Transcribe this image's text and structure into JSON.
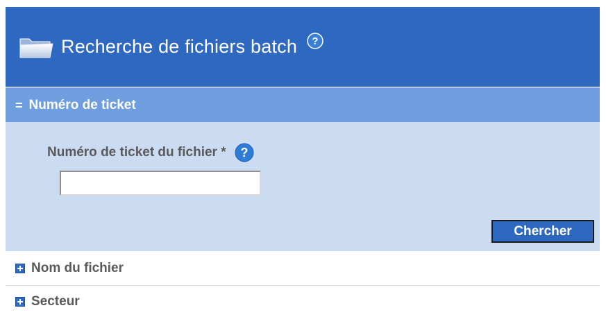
{
  "title": {
    "text": "Recherche de fichiers batch",
    "help_icon": "help-icon"
  },
  "section_ticket": {
    "heading": "Numéro de ticket",
    "expanded": true,
    "field_label": "Numéro de ticket du fichier *",
    "field_value": "",
    "search_button": "Chercher"
  },
  "collapsed_sections": [
    {
      "label": "Nom du fichier",
      "icon": "plus-icon"
    },
    {
      "label": "Secteur",
      "icon": "plus-icon"
    }
  ],
  "colors": {
    "title_bar": "#2f68c1",
    "section_head": "#6f9ee0",
    "section_body": "#cbdbf1",
    "button": "#2f68c1"
  }
}
